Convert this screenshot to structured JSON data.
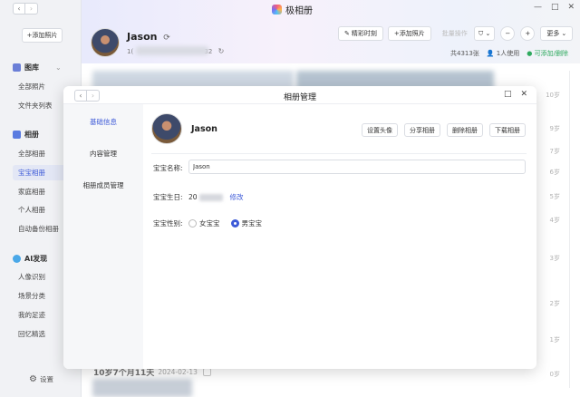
{
  "sidebar": {
    "add_photo": "+添加照片",
    "library_group": "图库",
    "library_items": [
      "全部照片",
      "文件夹列表"
    ],
    "album_group": "相册",
    "album_items": [
      "全部相册",
      "宝宝相册",
      "家庭相册",
      "个人相册",
      "自动备份相册"
    ],
    "ai_group": "AI发现",
    "ai_items": [
      "人像识别",
      "场景分类",
      "我的足迹",
      "回忆精选"
    ],
    "settings": "设置"
  },
  "header": {
    "app_title": "极相册",
    "user_name": "Jason",
    "user_id_prefix": "1(",
    "user_id_suffix": "32",
    "toolbar": {
      "highlights": "精彩时刻",
      "add_photo": "+添加照片",
      "ghost": "批量操作",
      "more": "更多"
    },
    "stats": {
      "total": "共4313张",
      "users": "1人使用",
      "deletable": "可添加/删除"
    }
  },
  "timeline": [
    "10岁",
    "9岁",
    "7岁",
    "6岁",
    "5岁",
    "4岁",
    "3岁",
    "2岁",
    "1岁",
    "0岁"
  ],
  "section": {
    "title": "10岁7个月11天",
    "date": "2024-02-13"
  },
  "modal": {
    "title": "相册管理",
    "tabs": [
      "基础信息",
      "内容管理",
      "相册成员管理"
    ],
    "name": "Jason",
    "actions": [
      "设置头像",
      "分享相册",
      "删除相册",
      "下载相册"
    ],
    "name_label": "宝宝名称:",
    "name_value": "Jason",
    "birthday_label": "宝宝生日:",
    "birthday_prefix": "20",
    "edit": "修改",
    "gender_label": "宝宝性别:",
    "gender_options": [
      "女宝宝",
      "男宝宝"
    ],
    "gender_selected": "男宝宝"
  },
  "colors": {
    "accent": "#3d5ad8",
    "green": "#2faa5f"
  }
}
